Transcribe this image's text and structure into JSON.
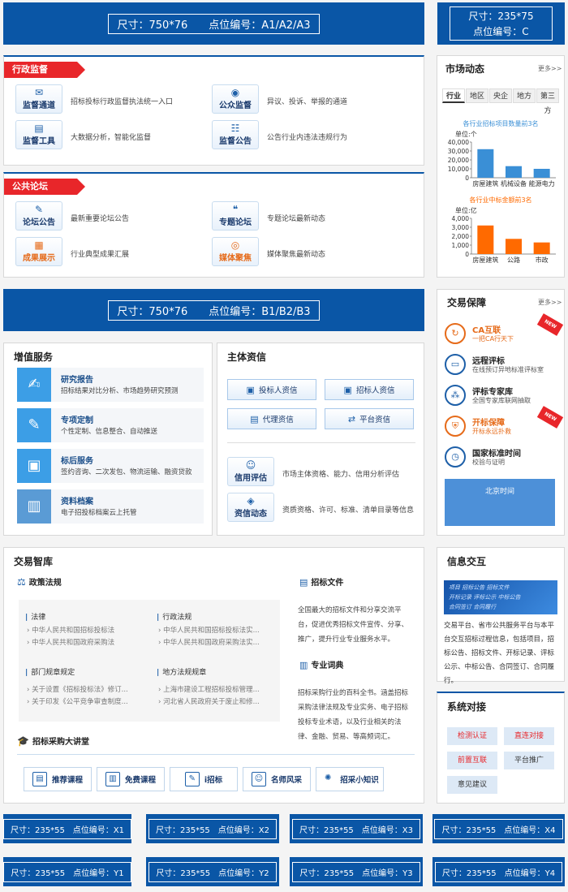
{
  "ads": {
    "top_a": {
      "size": "尺寸：750*76",
      "code": "点位编号：A1/A2/A3"
    },
    "top_c": {
      "size": "尺寸：235*75",
      "code": "点位编号：C"
    },
    "mid_b": {
      "size": "尺寸：750*76",
      "code": "点位编号：B1/B2/B3"
    },
    "small": [
      {
        "size": "尺寸：235*55",
        "code": "点位编号：X1"
      },
      {
        "size": "尺寸：235*55",
        "code": "点位编号：X2"
      },
      {
        "size": "尺寸：235*55",
        "code": "点位编号：X3"
      },
      {
        "size": "尺寸：235*55",
        "code": "点位编号：X4"
      },
      {
        "size": "尺寸：235*55",
        "code": "点位编号：Y1"
      },
      {
        "size": "尺寸：235*55",
        "code": "点位编号：Y2"
      },
      {
        "size": "尺寸：235*55",
        "code": "点位编号：Y3"
      },
      {
        "size": "尺寸：235*55",
        "code": "点位编号：Y4"
      }
    ]
  },
  "supervision": {
    "tag": "行政监督",
    "items": [
      {
        "label": "监督通道",
        "desc": "招标投标行政监督执法统一入口",
        "icon": "✉"
      },
      {
        "label": "公众监督",
        "desc": "异议、投诉、举报的通道",
        "icon": "◉"
      },
      {
        "label": "监督工具",
        "desc": "大数据分析，智能化监督",
        "icon": "▤"
      },
      {
        "label": "监督公告",
        "desc": "公告行业内违法违规行为",
        "icon": "☷"
      }
    ]
  },
  "forum": {
    "tag": "公共论坛",
    "items": [
      {
        "label": "论坛公告",
        "desc": "最新重要论坛公告",
        "icon": "✎"
      },
      {
        "label": "专题论坛",
        "desc": "专题论坛最新动态",
        "icon": "❝"
      },
      {
        "label": "成果展示",
        "desc": "行业典型成果汇展",
        "icon": "▦"
      },
      {
        "label": "媒体聚焦",
        "desc": "媒体聚焦最新动态",
        "icon": "◎"
      }
    ]
  },
  "market": {
    "title": "市场动态",
    "more": "更多>>",
    "tabs": [
      "行业",
      "地区",
      "央企",
      "地方",
      "第三方"
    ],
    "chart1_title": "各行业招标项目数量前3名",
    "chart2_title": "各行业中标金额前3名"
  },
  "chart_data": [
    {
      "type": "bar",
      "title": "各行业招标项目数量前3名",
      "ylabel": "单位:个",
      "categories": [
        "房屋建筑",
        "机械设备",
        "能源电力"
      ],
      "values": [
        32000,
        13000,
        10000
      ],
      "yticks": [
        "40,000",
        "30,000",
        "20,000",
        "10,000",
        "0"
      ],
      "ylim": [
        0,
        40000
      ],
      "color": "#3a8fd6"
    },
    {
      "type": "bar",
      "title": "各行业中标金额前3名",
      "ylabel": "单位:亿",
      "categories": [
        "房屋建筑",
        "公路",
        "市政"
      ],
      "values": [
        3200,
        1700,
        1300
      ],
      "yticks": [
        "4,000",
        "3,000",
        "2,000",
        "1,000",
        "0"
      ],
      "ylim": [
        0,
        4000
      ],
      "color": "#ff6a00"
    }
  ],
  "value_services": {
    "title": "增值服务",
    "items": [
      {
        "title": "研究报告",
        "desc": "招标结果对比分析、市场趋势研究预测",
        "icon": "✍"
      },
      {
        "title": "专项定制",
        "desc": "个性定制、信息整合、自动推送",
        "icon": "✎"
      },
      {
        "title": "标后服务",
        "desc": "签约咨询、二次发包、物流运输、融资贷款",
        "icon": "▣"
      },
      {
        "title": "资料档案",
        "desc": "电子招投标档案云上托管",
        "icon": "▥"
      }
    ]
  },
  "credit": {
    "title": "主体资信",
    "buttons": [
      "投标人资信",
      "招标人资信",
      "代理资信",
      "平台资信"
    ],
    "items": [
      {
        "label": "信用评估",
        "desc": "市场主体资格、能力、信用分析评估",
        "icon": "☺"
      },
      {
        "label": "资信动态",
        "desc": "资质资格、许可、标准、清单目录等信息",
        "icon": "◈"
      }
    ]
  },
  "trade_guarantee": {
    "title": "交易保障",
    "more": "更多>>",
    "items": [
      {
        "title": "CA互联",
        "desc": "一把CA行天下",
        "icon": "↻",
        "orange": true,
        "new": true
      },
      {
        "title": "远程评标",
        "desc": "在线预订异地标准评标室",
        "icon": "▭",
        "orange": false,
        "new": false
      },
      {
        "title": "评标专家库",
        "desc": "全国专家库联网抽取",
        "icon": "⁂",
        "orange": false,
        "new": false
      },
      {
        "title": "开标保障",
        "desc": "开标永远扑救",
        "icon": "⛨",
        "orange": true,
        "new": true
      },
      {
        "title": "国家标准时间",
        "desc": "校验与证明",
        "icon": "◷",
        "orange": false,
        "new": false
      }
    ],
    "new_label": "NEW",
    "beijing_time": "北京时间"
  },
  "library": {
    "title": "交易智库",
    "policy_title": "政策法规",
    "groups": [
      {
        "head": "法律",
        "lines": [
          "中华人民共和国招标投标法",
          "中华人民共和国政府采购法"
        ]
      },
      {
        "head": "行政法规",
        "lines": [
          "中华人民共和国招标投标法实...",
          "中华人民共和国政府采购法实..."
        ]
      },
      {
        "head": "部门规章规定",
        "lines": [
          "关于设置《招标投标法》修订...",
          "关于印发《公平竞争审查制度..."
        ]
      },
      {
        "head": "地方法规规章",
        "lines": [
          "上海市建设工程招标投标管理...",
          "河北省人民政府关于废止和修..."
        ]
      }
    ],
    "files_title": "招标文件",
    "files_desc": "全国最大的招标文件和分享交流平台，促进优秀招标文件宣传、分享、推广，提升行业专业服务水平。",
    "dict_title": "专业词典",
    "dict_desc": "招标采购行业的百科全书。涵盖招标采购法律法规及专业实务、电子招标投标专业术语，以及行业相关的法律、金融、贸易、等高频词汇。",
    "lecture_title": "招标采购大讲堂",
    "lectures": [
      {
        "label": "推荐课程",
        "icon": "▤"
      },
      {
        "label": "免费课程",
        "icon": "▥"
      },
      {
        "label": "i招标",
        "icon": "✎"
      },
      {
        "label": "名师风采",
        "icon": "☺"
      },
      {
        "label": "招采小知识",
        "icon": "✺"
      }
    ]
  },
  "info": {
    "title": "信息交互",
    "banner": [
      "项目",
      "招标公告",
      "招标文件",
      "开标记录",
      "评标公示",
      "中标公告",
      "合同签订",
      "合同履行"
    ],
    "desc": "交易平台、省市公共服务平台与本平台交互招标过程信息，包括项目，招标公告、招标文件、开标记录、评标公示、中标公告、合同签订、合同履行。"
  },
  "system": {
    "title": "系统对接",
    "buttons": [
      {
        "label": "检测认证",
        "red": true
      },
      {
        "label": "直连对接",
        "red": true
      },
      {
        "label": "前置互联",
        "red": true
      },
      {
        "label": "平台推广",
        "red": false
      },
      {
        "label": "意见建议",
        "red": false
      }
    ]
  }
}
